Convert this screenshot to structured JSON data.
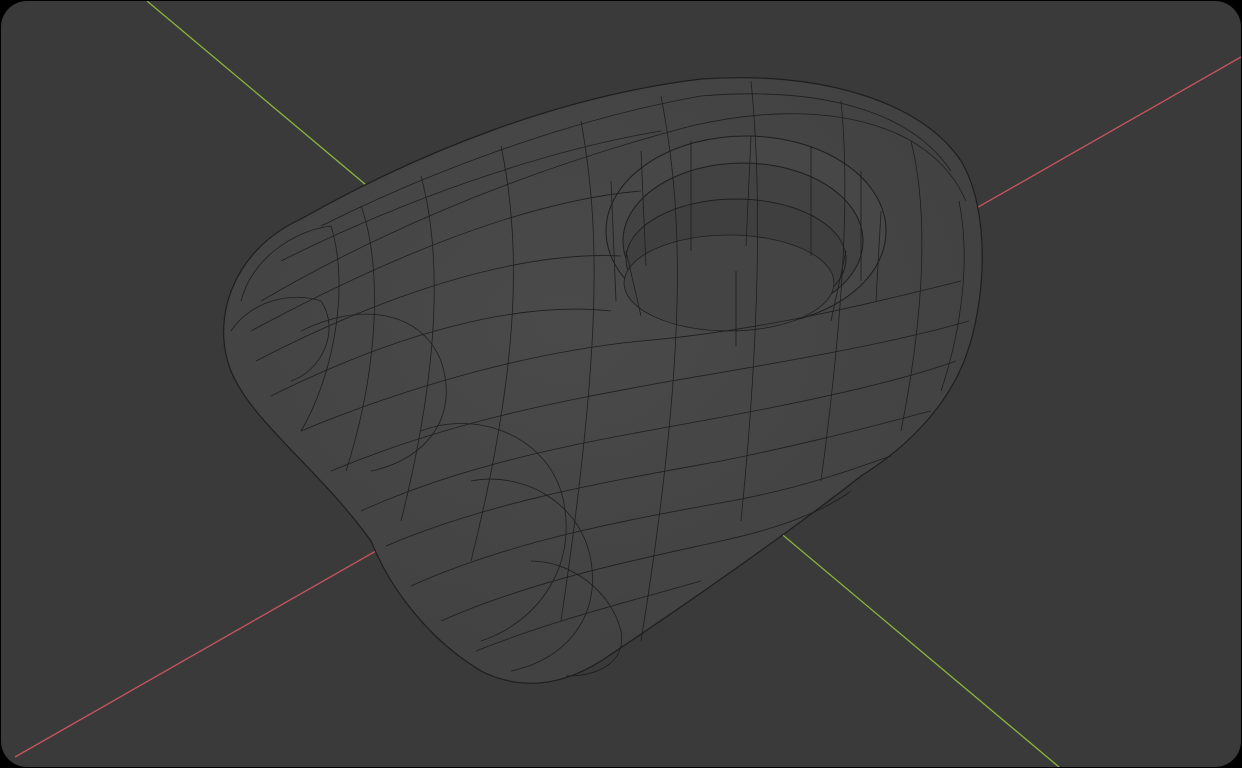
{
  "viewport": {
    "background_color": "#3a3a3a",
    "mesh_fill_color": "#454545",
    "mesh_wire_color": "#1e1e1e",
    "shading_mode": "wireframe-overlay"
  },
  "axes": {
    "x_axis_color": "#c8555f",
    "y_axis_color": "#8cb43c"
  },
  "object": {
    "shape": "rounded-capsule-with-recessed-cup",
    "icon": "mesh-object-icon"
  }
}
